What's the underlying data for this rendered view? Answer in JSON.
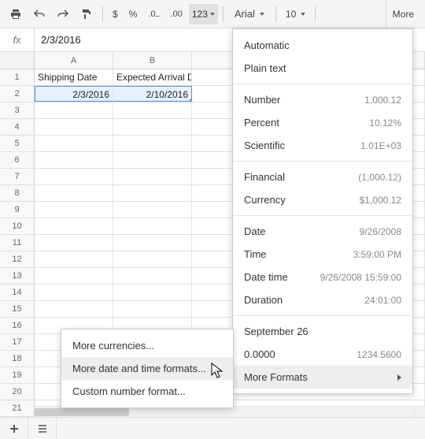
{
  "toolbar": {
    "format_btn": "123",
    "font": "Arial",
    "size": "10",
    "more": "More"
  },
  "formula_bar": {
    "label": "fx",
    "value": "2/3/2016"
  },
  "columns": [
    "A",
    "B"
  ],
  "rows": [
    {
      "n": "1",
      "a": "Shipping Date",
      "b": "Expected Arrival Date",
      "align": "left"
    },
    {
      "n": "2",
      "a": "2/3/2016",
      "b": "2/10/2016",
      "align": "right",
      "selected": true
    },
    {
      "n": "3"
    },
    {
      "n": "4"
    },
    {
      "n": "5"
    },
    {
      "n": "6"
    },
    {
      "n": "7"
    },
    {
      "n": "8"
    },
    {
      "n": "9"
    },
    {
      "n": "10"
    },
    {
      "n": "11"
    },
    {
      "n": "12"
    },
    {
      "n": "13"
    },
    {
      "n": "14"
    },
    {
      "n": "15"
    },
    {
      "n": "16"
    },
    {
      "n": "17"
    },
    {
      "n": "18"
    },
    {
      "n": "19"
    },
    {
      "n": "20"
    },
    {
      "n": "21"
    }
  ],
  "format_menu": {
    "automatic": "Automatic",
    "plain": "Plain text",
    "number": {
      "label": "Number",
      "ex": "1,000.12"
    },
    "percent": {
      "label": "Percent",
      "ex": "10.12%"
    },
    "scientific": {
      "label": "Scientific",
      "ex": "1.01E+03"
    },
    "financial": {
      "label": "Financial",
      "ex": "(1,000.12)"
    },
    "currency": {
      "label": "Currency",
      "ex": "$1,000.12"
    },
    "date": {
      "label": "Date",
      "ex": "9/26/2008"
    },
    "time": {
      "label": "Time",
      "ex": "3:59:00 PM"
    },
    "datetime": {
      "label": "Date time",
      "ex": "9/26/2008 15:59:00"
    },
    "duration": {
      "label": "Duration",
      "ex": "24:01:00"
    },
    "monthday": {
      "label": "September 26"
    },
    "decimal": {
      "label": "0.0000",
      "ex": "1234.5600"
    },
    "more": "More Formats"
  },
  "submenu": {
    "currencies": "More currencies...",
    "datetime": "More date and time formats...",
    "custom": "Custom number format..."
  }
}
